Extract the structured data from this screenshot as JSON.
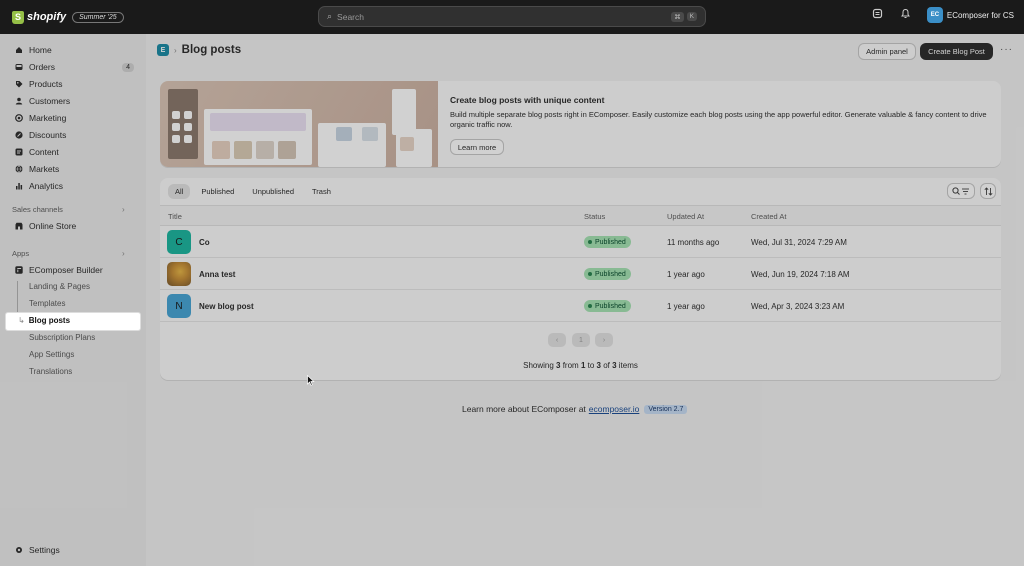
{
  "topbar": {
    "logo_text": "shopify",
    "logo_letter": "S",
    "edition_badge": "Summer '25",
    "search_placeholder": "Search",
    "shortcut_keys": [
      "⌘",
      "K"
    ],
    "store_initials": "EC",
    "store_name": "EComposer for CS"
  },
  "sidebar": {
    "items": [
      {
        "label": "Home",
        "icon": "home-icon"
      },
      {
        "label": "Orders",
        "icon": "orders-icon",
        "badge": "4"
      },
      {
        "label": "Products",
        "icon": "tag-icon"
      },
      {
        "label": "Customers",
        "icon": "person-icon"
      },
      {
        "label": "Marketing",
        "icon": "target-icon"
      },
      {
        "label": "Discounts",
        "icon": "discount-icon"
      },
      {
        "label": "Content",
        "icon": "content-icon"
      },
      {
        "label": "Markets",
        "icon": "globe-icon"
      },
      {
        "label": "Analytics",
        "icon": "bar-chart-icon"
      }
    ],
    "sales_channels_label": "Sales channels",
    "online_store_label": "Online Store",
    "apps_label": "Apps",
    "app_name": "EComposer Builder",
    "app_sub_items": [
      "Landing & Pages",
      "Templates",
      "Blog posts",
      "Subscription Plans",
      "App Settings",
      "Translations"
    ],
    "active_sub_item": "Blog posts",
    "settings_label": "Settings"
  },
  "header": {
    "app_icon_letter": "E",
    "title": "Blog posts",
    "admin_panel_label": "Admin panel",
    "create_label": "Create Blog Post",
    "more_label": "···"
  },
  "banner": {
    "title": "Create blog posts with unique content",
    "text": "Build multiple separate blog posts right in EComposer. Easily customize each blog posts using the app powerful editor. Generate valuable & fancy content to drive organic traffic now.",
    "button_label": "Learn more"
  },
  "table": {
    "tabs": [
      "All",
      "Published",
      "Unpublished",
      "Trash"
    ],
    "active_tab": "All",
    "columns": [
      "Title",
      "Status",
      "Updated At",
      "Created At"
    ],
    "rows": [
      {
        "initial": "C",
        "title": "Co",
        "status": "Published",
        "updated": "11 months ago",
        "created": "Wed, Jul 31, 2024 7:29 AM",
        "thumb_color": "#1fb8a2"
      },
      {
        "initial": "",
        "title": "Anna test",
        "status": "Published",
        "updated": "1 year ago",
        "created": "Wed, Jun 19, 2024 7:18 AM",
        "thumb_color": "#c9a45a"
      },
      {
        "initial": "N",
        "title": "New blog post",
        "status": "Published",
        "updated": "1 year ago",
        "created": "Wed, Apr 3, 2024 3:23 AM",
        "thumb_color": "#4aa6d6"
      }
    ],
    "pagination": {
      "prev": "‹",
      "page": "1",
      "next": "›"
    },
    "showing": {
      "prefix": "Showing ",
      "count": "3",
      "from_word": " from ",
      "from": "1",
      "to_word": " to ",
      "to": "3",
      "of_word": " of ",
      "total": "3",
      "suffix": " items"
    }
  },
  "footer": {
    "text": "Learn more about EComposer at",
    "link": "ecomposer.io",
    "version": "Version 2.7"
  },
  "colors": {
    "topbar": "#1a1a1a",
    "primary_button": "#303030",
    "published_badge": "#a7e3b4",
    "link": "#1f5199"
  }
}
